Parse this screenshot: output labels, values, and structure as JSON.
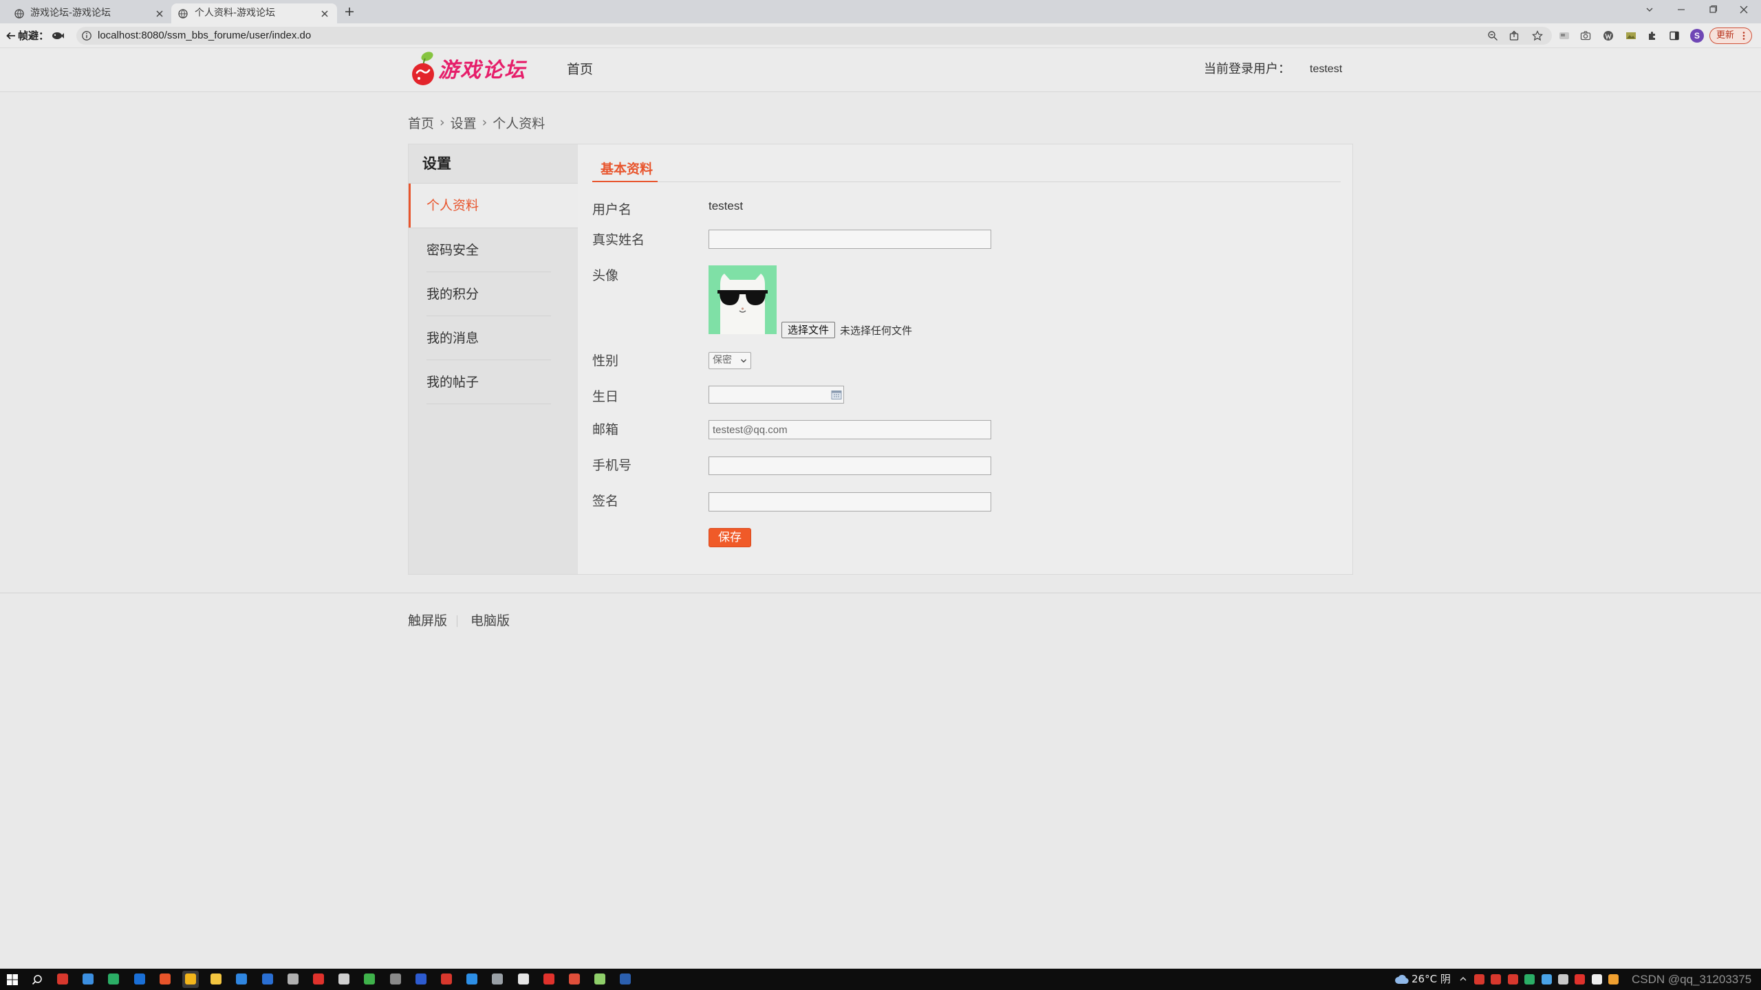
{
  "browser": {
    "tabs": [
      {
        "title": "游戏论坛-游戏论坛",
        "active": false
      },
      {
        "title": "个人资料-游戏论坛",
        "active": true
      }
    ],
    "address_prefix": "帧避：",
    "url": "localhost:8080/ssm_bbs_forume/user/index.do",
    "profile_initial": "S",
    "update_button": "更新",
    "icons": [
      "globe-icon",
      "close-icon",
      "new-tab-icon",
      "back-icon",
      "info-icon",
      "zoom-icon",
      "share-icon",
      "star-icon",
      "extension-icon",
      "camera-icon",
      "puzzle-icon",
      "side-panel-icon",
      "more-icon"
    ]
  },
  "site": {
    "logo_text": "游戏论坛",
    "nav": [
      {
        "label": "首页"
      }
    ],
    "user_label": "当前登录用户：",
    "username": "testest"
  },
  "breadcrumb": {
    "items": [
      "首页",
      "设置",
      "个人资料"
    ],
    "separator": "›"
  },
  "sidebar": {
    "title": "设置",
    "items": [
      {
        "label": "个人资料",
        "active": true
      },
      {
        "label": "密码安全",
        "active": false
      },
      {
        "label": "我的积分",
        "active": false
      },
      {
        "label": "我的消息",
        "active": false
      },
      {
        "label": "我的帖子",
        "active": false
      }
    ]
  },
  "content": {
    "tab": "基本资料"
  },
  "form": {
    "username": {
      "label": "用户名",
      "value": "testest"
    },
    "realname": {
      "label": "真实姓名",
      "value": ""
    },
    "avatar": {
      "label": "头像",
      "file_button": "选择文件",
      "file_status": "未选择任何文件"
    },
    "gender": {
      "label": "性别",
      "selected": "保密"
    },
    "birthday": {
      "label": "生日",
      "value": ""
    },
    "email": {
      "label": "邮箱",
      "value": "testest@qq.com"
    },
    "phone": {
      "label": "手机号",
      "value": ""
    },
    "signature": {
      "label": "签名",
      "value": ""
    },
    "save_button": "保存"
  },
  "footer": {
    "links": [
      "触屏版",
      "电脑版"
    ]
  },
  "taskbar": {
    "weather": "26°C 阴",
    "watermark": "CSDN @qq_31203375",
    "apps": [
      {
        "name": "game-app-icon",
        "color": "#d8382d"
      },
      {
        "name": "help-app-icon",
        "color": "#3c8fe0"
      },
      {
        "name": "wechat-icon",
        "color": "#2bae66"
      },
      {
        "name": "ide-icon",
        "color": "#1a6fd6"
      },
      {
        "name": "wps-icon",
        "color": "#e8542a"
      },
      {
        "name": "chrome-icon",
        "color": "#f2b51b",
        "active": true
      },
      {
        "name": "file-explorer-icon",
        "color": "#f3c540"
      },
      {
        "name": "edge-icon",
        "color": "#2f86e0"
      },
      {
        "name": "uninstaller-icon",
        "color": "#2a6fd3"
      },
      {
        "name": "archive-icon",
        "color": "#b0b0b0"
      },
      {
        "name": "screen-recorder-icon",
        "color": "#e0322c"
      },
      {
        "name": "remote-desktop-icon",
        "color": "#d0d0d0"
      },
      {
        "name": "sync-icon",
        "color": "#3fb24b"
      },
      {
        "name": "game-controller-icon",
        "color": "#8a8a8a"
      },
      {
        "name": "typora-icon",
        "color": "#2d5bd0"
      },
      {
        "name": "game-app-icon",
        "color": "#d8382d"
      },
      {
        "name": "vscode-icon",
        "color": "#2d8fe6"
      },
      {
        "name": "drive-icon",
        "color": "#9aa0a6"
      },
      {
        "name": "settings-app-icon",
        "color": "#e6e6e6"
      },
      {
        "name": "screen-recorder-icon",
        "color": "#e0322c"
      },
      {
        "name": "app-launcher-icon",
        "color": "#e04f3a"
      },
      {
        "name": "notepad-icon",
        "color": "#8fcf6a"
      },
      {
        "name": "word-icon",
        "color": "#2b5fae"
      }
    ],
    "tray": [
      {
        "name": "game-tray-icon",
        "color": "#d8382d"
      },
      {
        "name": "game-tray-icon",
        "color": "#d8382d"
      },
      {
        "name": "game-tray-icon",
        "color": "#d8382d"
      },
      {
        "name": "wechat-tray-icon",
        "color": "#2bae66"
      },
      {
        "name": "network-tray-icon",
        "color": "#4aa3e6"
      },
      {
        "name": "storage-tray-icon",
        "color": "#c8c8c8"
      },
      {
        "name": "record-tray-icon",
        "color": "#e0322c"
      },
      {
        "name": "microphone-tray-icon",
        "color": "#eeeeee"
      },
      {
        "name": "search-tray-icon",
        "color": "#f0a030"
      }
    ]
  },
  "colors": {
    "accent": "#e8552d",
    "save_button": "#f05a28",
    "logo": "#e61e6a",
    "avatar_background": "#7fe0a6"
  }
}
